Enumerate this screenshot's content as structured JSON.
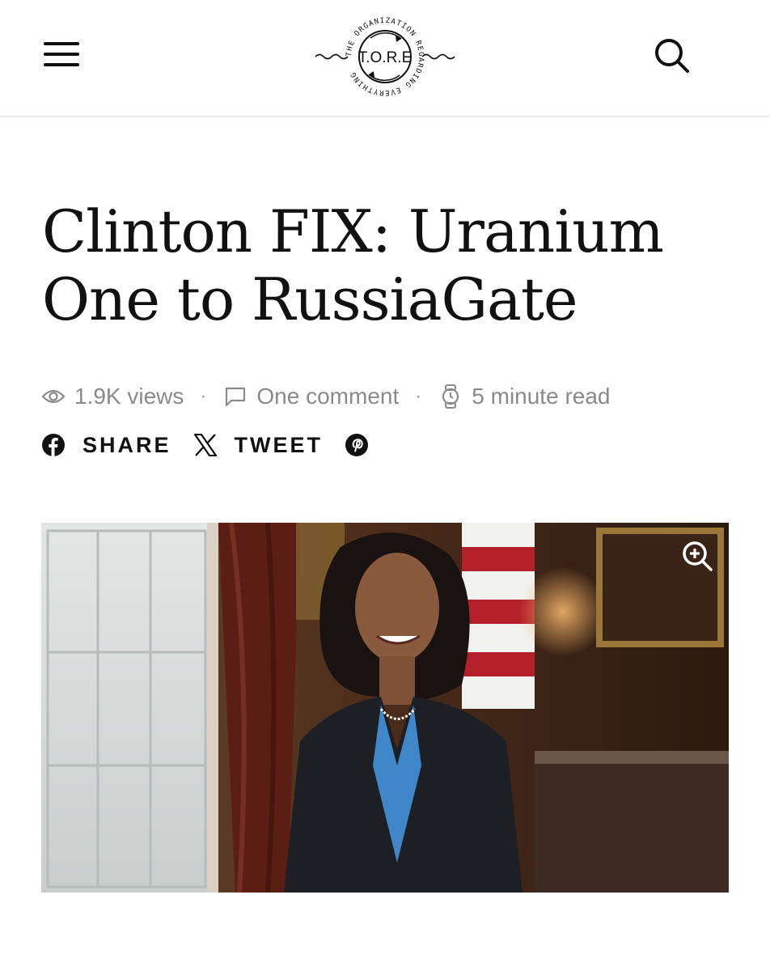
{
  "header": {
    "logo_text": "T.O.R.E",
    "logo_ring_text": "THE ORGANIZATION REGARDING EVERYTHING",
    "menu_icon": "hamburger-menu-icon",
    "search_icon": "search-icon"
  },
  "article": {
    "title": "Clinton FIX: Uranium One to RussiaGate",
    "views": "1.9K views",
    "comments": "One comment",
    "read_time": "5 minute read",
    "separator": "·"
  },
  "share": {
    "facebook_label": "SHARE",
    "x_label": "TWEET"
  },
  "hero": {
    "zoom_icon": "zoom-in-icon"
  },
  "colors": {
    "text": "#111111",
    "meta": "#8a8a8a",
    "divider": "#ececec"
  }
}
